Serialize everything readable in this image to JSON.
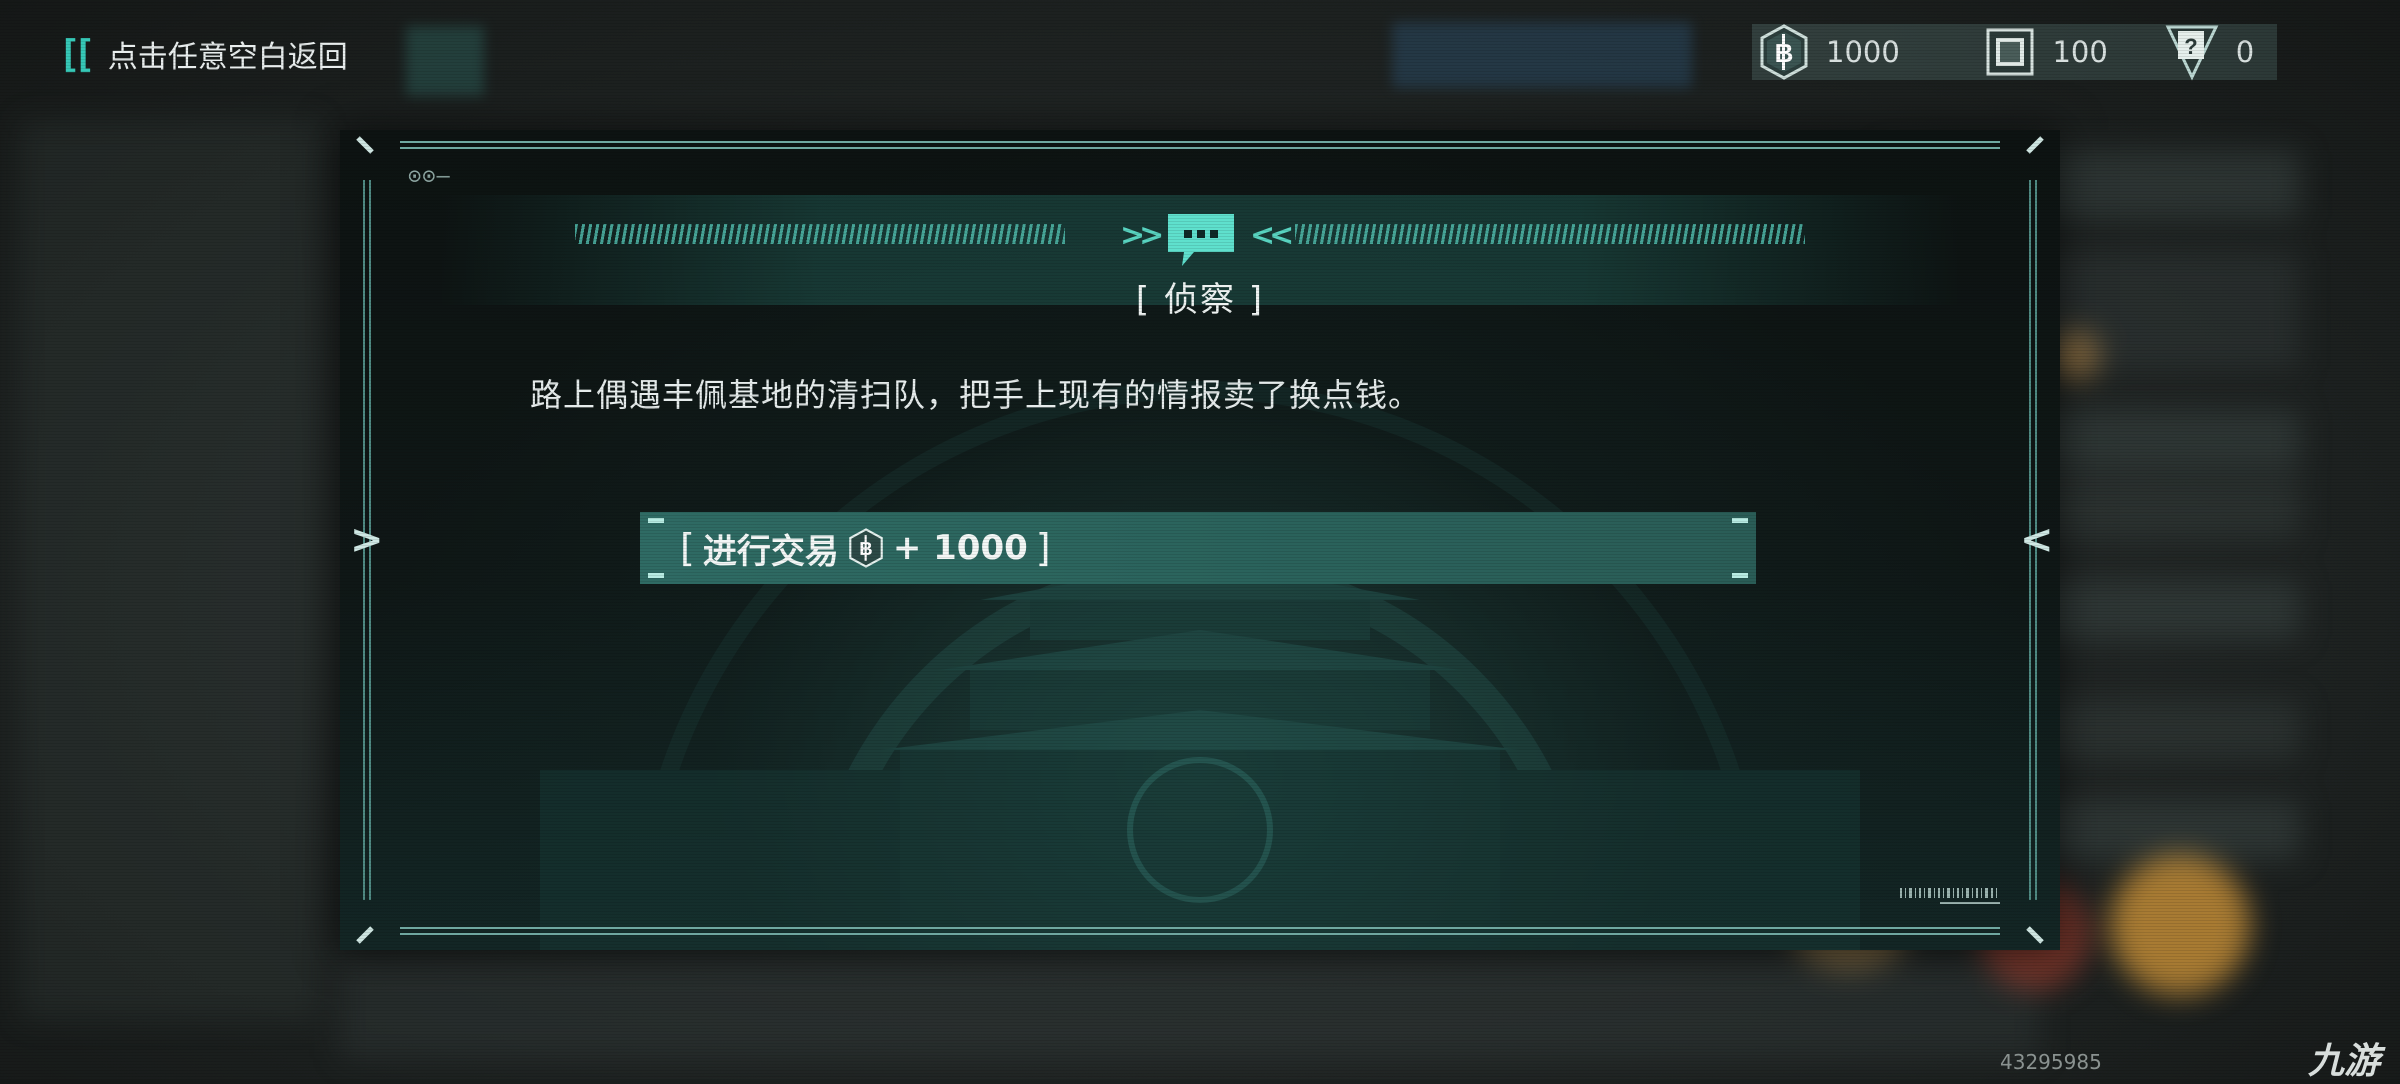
{
  "top_bar": {
    "back_hint": "点击任意空白返回"
  },
  "resources": [
    {
      "icon": "coin-icon",
      "value": "1000"
    },
    {
      "icon": "card-icon",
      "value": "100"
    },
    {
      "icon": "intel-icon",
      "value": "0"
    }
  ],
  "dialog": {
    "title": "[ 侦察 ]",
    "text": "路上偶遇丰佩基地的清扫队，把手上现有的情报卖了换点钱。",
    "option": {
      "open_bracket": "[",
      "label": "进行交易",
      "icon": "coin-icon",
      "amount": "+ 1000",
      "close_bracket": "]"
    }
  },
  "footer": {
    "image_id": "43295985",
    "site_logo": "九游"
  },
  "colors": {
    "accent": "#36c8b7",
    "button": "#2f6b64",
    "frame": "#9fd3cb"
  }
}
